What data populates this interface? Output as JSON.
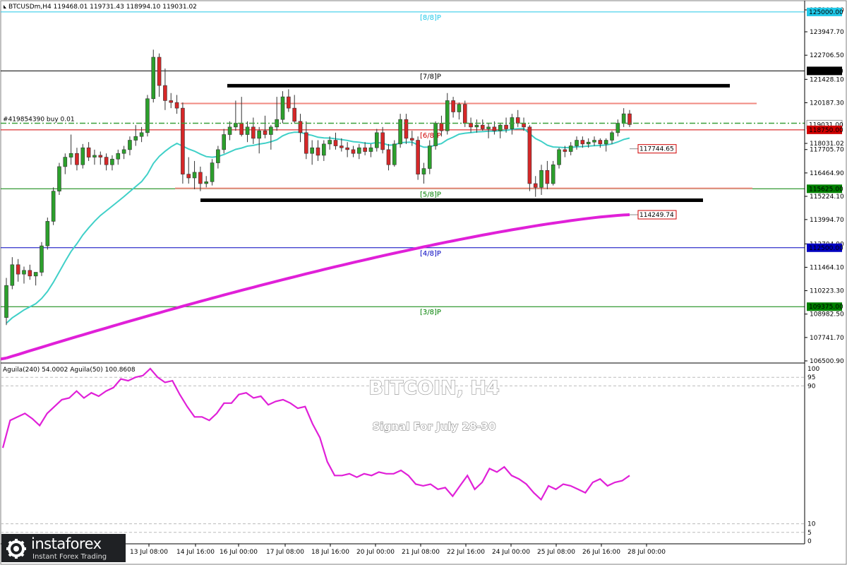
{
  "header": {
    "symbol_line": "BTCUSDm,H4  119468.01 119731.43 118994.10 119031.02",
    "indicator_line": "Aguila(240) 54.0002  Aguila(50) 100.8608",
    "order_label": "#419854390 buy 0.01"
  },
  "overlay": {
    "title": "BITCOIN, H4",
    "subtitle": "Signal For July 28-30"
  },
  "logo": {
    "name": "instaforex",
    "tagline": "Instant Forex Trading"
  },
  "colors": {
    "up_candle": "#2ca02c",
    "down_candle": "#d62728",
    "ema_fast": "#40d0c8",
    "ma_slow": "#e020d8",
    "oscillator": "#e020d8"
  },
  "chart_data": {
    "type": "candlestick",
    "timeframe": "H4",
    "y_axis_labels": [
      "125109.10",
      "123947.70",
      "122706.50",
      "121428.10",
      "120187.30",
      "118031.02",
      "117705.70",
      "116464.90",
      "115224.10",
      "113994.70",
      "112704.90",
      "111464.10",
      "110223.30",
      "108982.50",
      "107741.70",
      "106500.90"
    ],
    "x_axis_labels": [
      "13 Jul 08:00",
      "14 Jul 16:00",
      "16 Jul 00:00",
      "17 Jul 08:00",
      "18 Jul 16:00",
      "20 Jul 00:00",
      "21 Jul 08:00",
      "22 Jul 16:00",
      "24 Jul 00:00",
      "25 Jul 08:00",
      "26 Jul 16:00",
      "28 Jul 00:00"
    ],
    "levels": [
      {
        "label": "[8/8]P",
        "price": 125000.0,
        "price_label": "125000.00",
        "color": "#20c8e8"
      },
      {
        "label": "[7/8]P",
        "price": 121875.0,
        "price_label": "121875.00",
        "color": "#000000"
      },
      {
        "label": "[6/8]P",
        "price": 118750.0,
        "price_label": "118750.00",
        "color": "#d00000"
      },
      {
        "label": "[5/8]P",
        "price": 115625.0,
        "price_label": "115625.00",
        "color": "#008000"
      },
      {
        "label": "[4/8]P",
        "price": 112500.0,
        "price_label": "112500.00",
        "color": "#0000c0"
      },
      {
        "label": "[3/8]P",
        "price": 109375.0,
        "price_label": "109375.00",
        "color": "#008000"
      }
    ],
    "indicator_labels": [
      {
        "value": 117744.65,
        "label": "117744.65",
        "color": "#d00000"
      },
      {
        "value": 114249.74,
        "label": "114249.74",
        "color": "#d00000"
      }
    ],
    "candles": [
      {
        "o": 108800,
        "h": 110900,
        "l": 108400,
        "c": 110500
      },
      {
        "o": 110500,
        "h": 112000,
        "l": 110300,
        "c": 111600
      },
      {
        "o": 111600,
        "h": 111900,
        "l": 110700,
        "c": 111100
      },
      {
        "o": 111100,
        "h": 111500,
        "l": 110600,
        "c": 111300
      },
      {
        "o": 111300,
        "h": 111600,
        "l": 110800,
        "c": 111000
      },
      {
        "o": 111000,
        "h": 111200,
        "l": 110500,
        "c": 111200
      },
      {
        "o": 111200,
        "h": 112800,
        "l": 111000,
        "c": 112600
      },
      {
        "o": 112600,
        "h": 114100,
        "l": 112400,
        "c": 113900
      },
      {
        "o": 113900,
        "h": 115700,
        "l": 113700,
        "c": 115500
      },
      {
        "o": 115500,
        "h": 117000,
        "l": 115300,
        "c": 116800
      },
      {
        "o": 116800,
        "h": 117500,
        "l": 116400,
        "c": 117300
      },
      {
        "o": 117300,
        "h": 118500,
        "l": 116900,
        "c": 117500
      },
      {
        "o": 117500,
        "h": 117800,
        "l": 116600,
        "c": 116900
      },
      {
        "o": 116900,
        "h": 118000,
        "l": 116700,
        "c": 117800
      },
      {
        "o": 117800,
        "h": 118100,
        "l": 117100,
        "c": 117300
      },
      {
        "o": 117300,
        "h": 117700,
        "l": 116900,
        "c": 117400
      },
      {
        "o": 117400,
        "h": 117600,
        "l": 116900,
        "c": 117300
      },
      {
        "o": 117300,
        "h": 117500,
        "l": 116600,
        "c": 116900
      },
      {
        "o": 116900,
        "h": 117400,
        "l": 116600,
        "c": 117200
      },
      {
        "o": 117200,
        "h": 117700,
        "l": 116900,
        "c": 117500
      },
      {
        "o": 117500,
        "h": 117900,
        "l": 117200,
        "c": 117700
      },
      {
        "o": 117700,
        "h": 118400,
        "l": 117400,
        "c": 118200
      },
      {
        "o": 118200,
        "h": 119000,
        "l": 117900,
        "c": 118400
      },
      {
        "o": 118400,
        "h": 118900,
        "l": 118100,
        "c": 118600
      },
      {
        "o": 118600,
        "h": 120600,
        "l": 118400,
        "c": 120400
      },
      {
        "o": 120400,
        "h": 123000,
        "l": 120200,
        "c": 122600
      },
      {
        "o": 122600,
        "h": 122800,
        "l": 120500,
        "c": 121100
      },
      {
        "o": 121100,
        "h": 122000,
        "l": 119800,
        "c": 120300
      },
      {
        "o": 120300,
        "h": 120700,
        "l": 119900,
        "c": 120200
      },
      {
        "o": 120200,
        "h": 120600,
        "l": 119600,
        "c": 119900
      },
      {
        "o": 119900,
        "h": 120200,
        "l": 115900,
        "c": 116400
      },
      {
        "o": 116400,
        "h": 117300,
        "l": 115900,
        "c": 116200
      },
      {
        "o": 116200,
        "h": 117100,
        "l": 115600,
        "c": 116500
      },
      {
        "o": 116500,
        "h": 116800,
        "l": 115500,
        "c": 115900
      },
      {
        "o": 115900,
        "h": 116300,
        "l": 115700,
        "c": 116000
      },
      {
        "o": 116000,
        "h": 117200,
        "l": 115800,
        "c": 117000
      },
      {
        "o": 117000,
        "h": 117900,
        "l": 116700,
        "c": 117700
      },
      {
        "o": 117700,
        "h": 118800,
        "l": 117500,
        "c": 118500
      },
      {
        "o": 118500,
        "h": 119200,
        "l": 118200,
        "c": 118900
      },
      {
        "o": 118900,
        "h": 120300,
        "l": 118700,
        "c": 119100
      },
      {
        "o": 119100,
        "h": 120500,
        "l": 118400,
        "c": 118500
      },
      {
        "o": 118500,
        "h": 119200,
        "l": 118100,
        "c": 118900
      },
      {
        "o": 118900,
        "h": 119400,
        "l": 118000,
        "c": 118300
      },
      {
        "o": 118300,
        "h": 118900,
        "l": 117500,
        "c": 118700
      },
      {
        "o": 118700,
        "h": 119500,
        "l": 118300,
        "c": 118500
      },
      {
        "o": 118500,
        "h": 119000,
        "l": 117700,
        "c": 118900
      },
      {
        "o": 118900,
        "h": 120500,
        "l": 118700,
        "c": 119300
      },
      {
        "o": 119300,
        "h": 120800,
        "l": 119100,
        "c": 120500
      },
      {
        "o": 120500,
        "h": 120900,
        "l": 119700,
        "c": 119900
      },
      {
        "o": 119900,
        "h": 120600,
        "l": 119100,
        "c": 119200
      },
      {
        "o": 119200,
        "h": 119600,
        "l": 118100,
        "c": 118600
      },
      {
        "o": 118600,
        "h": 119200,
        "l": 117200,
        "c": 117500
      },
      {
        "o": 117500,
        "h": 118200,
        "l": 116900,
        "c": 117800
      },
      {
        "o": 117800,
        "h": 118200,
        "l": 117100,
        "c": 117400
      },
      {
        "o": 117400,
        "h": 118200,
        "l": 117100,
        "c": 118000
      },
      {
        "o": 118000,
        "h": 118400,
        "l": 117700,
        "c": 118200
      },
      {
        "o": 118200,
        "h": 118600,
        "l": 117700,
        "c": 117900
      },
      {
        "o": 117900,
        "h": 118300,
        "l": 117600,
        "c": 117800
      },
      {
        "o": 117800,
        "h": 118100,
        "l": 117300,
        "c": 117700
      },
      {
        "o": 117700,
        "h": 117900,
        "l": 117300,
        "c": 117500
      },
      {
        "o": 117500,
        "h": 118000,
        "l": 117200,
        "c": 117800
      },
      {
        "o": 117800,
        "h": 118100,
        "l": 117400,
        "c": 117600
      },
      {
        "o": 117600,
        "h": 118000,
        "l": 117300,
        "c": 117800
      },
      {
        "o": 117800,
        "h": 118800,
        "l": 117600,
        "c": 118600
      },
      {
        "o": 118600,
        "h": 118900,
        "l": 117500,
        "c": 117700
      },
      {
        "o": 117700,
        "h": 118000,
        "l": 116600,
        "c": 116900
      },
      {
        "o": 116900,
        "h": 118200,
        "l": 116800,
        "c": 118000
      },
      {
        "o": 118000,
        "h": 119600,
        "l": 117800,
        "c": 119300
      },
      {
        "o": 119300,
        "h": 119600,
        "l": 118000,
        "c": 118300
      },
      {
        "o": 118300,
        "h": 118700,
        "l": 117900,
        "c": 118200
      },
      {
        "o": 118200,
        "h": 118400,
        "l": 116100,
        "c": 116400
      },
      {
        "o": 116400,
        "h": 117000,
        "l": 115900,
        "c": 116700
      },
      {
        "o": 116700,
        "h": 118200,
        "l": 116400,
        "c": 117900
      },
      {
        "o": 117900,
        "h": 119200,
        "l": 117700,
        "c": 119100
      },
      {
        "o": 119100,
        "h": 119500,
        "l": 118400,
        "c": 118700
      },
      {
        "o": 118700,
        "h": 120700,
        "l": 118500,
        "c": 120300
      },
      {
        "o": 120300,
        "h": 120500,
        "l": 119400,
        "c": 119700
      },
      {
        "o": 119700,
        "h": 120200,
        "l": 119300,
        "c": 120100
      },
      {
        "o": 120100,
        "h": 120300,
        "l": 118900,
        "c": 119100
      },
      {
        "o": 119100,
        "h": 119400,
        "l": 118600,
        "c": 118900
      },
      {
        "o": 118900,
        "h": 119300,
        "l": 118600,
        "c": 119000
      },
      {
        "o": 119000,
        "h": 119300,
        "l": 118700,
        "c": 118800
      },
      {
        "o": 118800,
        "h": 119100,
        "l": 118300,
        "c": 118900
      },
      {
        "o": 118900,
        "h": 119200,
        "l": 118500,
        "c": 118700
      },
      {
        "o": 118700,
        "h": 119100,
        "l": 118300,
        "c": 119000
      },
      {
        "o": 119000,
        "h": 119400,
        "l": 118600,
        "c": 118800
      },
      {
        "o": 118800,
        "h": 119600,
        "l": 118500,
        "c": 119400
      },
      {
        "o": 119400,
        "h": 119800,
        "l": 118900,
        "c": 119100
      },
      {
        "o": 119100,
        "h": 119400,
        "l": 118700,
        "c": 118900
      },
      {
        "o": 118900,
        "h": 119000,
        "l": 115500,
        "c": 115900
      },
      {
        "o": 115900,
        "h": 116300,
        "l": 115200,
        "c": 115700
      },
      {
        "o": 115700,
        "h": 116900,
        "l": 115300,
        "c": 116600
      },
      {
        "o": 116600,
        "h": 117100,
        "l": 115600,
        "c": 115900
      },
      {
        "o": 115900,
        "h": 117100,
        "l": 115800,
        "c": 116900
      },
      {
        "o": 116900,
        "h": 117800,
        "l": 116700,
        "c": 117700
      },
      {
        "o": 117700,
        "h": 117900,
        "l": 117300,
        "c": 117600
      },
      {
        "o": 117600,
        "h": 118100,
        "l": 117400,
        "c": 117900
      },
      {
        "o": 117900,
        "h": 118400,
        "l": 117700,
        "c": 118200
      },
      {
        "o": 118200,
        "h": 118400,
        "l": 117800,
        "c": 118000
      },
      {
        "o": 118000,
        "h": 118300,
        "l": 117800,
        "c": 118100
      },
      {
        "o": 118100,
        "h": 118400,
        "l": 117900,
        "c": 118200
      },
      {
        "o": 118200,
        "h": 118300,
        "l": 117800,
        "c": 118000
      },
      {
        "o": 118000,
        "h": 118300,
        "l": 117600,
        "c": 118200
      },
      {
        "o": 118200,
        "h": 118700,
        "l": 118000,
        "c": 118600
      },
      {
        "o": 118600,
        "h": 119300,
        "l": 118400,
        "c": 119100
      },
      {
        "o": 119100,
        "h": 119900,
        "l": 118900,
        "c": 119600
      },
      {
        "o": 119600,
        "h": 119800,
        "l": 118900,
        "c": 119031
      }
    ],
    "oscillator": {
      "scale_labels": [
        "100",
        "95",
        "90",
        "10",
        "5",
        "0"
      ],
      "values": [
        54,
        70,
        72,
        74,
        71,
        67,
        74,
        78,
        82,
        83,
        87,
        83,
        86,
        84,
        87,
        89,
        94,
        93,
        95,
        96,
        100,
        95,
        92,
        93,
        85,
        78,
        72,
        72,
        70,
        74,
        80,
        80,
        85,
        86,
        83,
        84,
        79,
        81,
        82,
        80,
        77,
        78,
        68,
        60,
        46,
        38,
        38,
        39,
        37,
        39,
        38,
        40,
        39,
        39,
        41,
        38,
        33,
        32,
        33,
        30,
        31,
        26,
        32,
        38,
        30,
        34,
        42,
        40,
        43,
        38,
        36,
        33,
        28,
        24,
        32,
        30,
        33,
        32,
        30,
        28,
        34,
        36,
        32,
        34,
        35,
        38
      ],
      "ylim": [
        0,
        100
      ]
    }
  }
}
